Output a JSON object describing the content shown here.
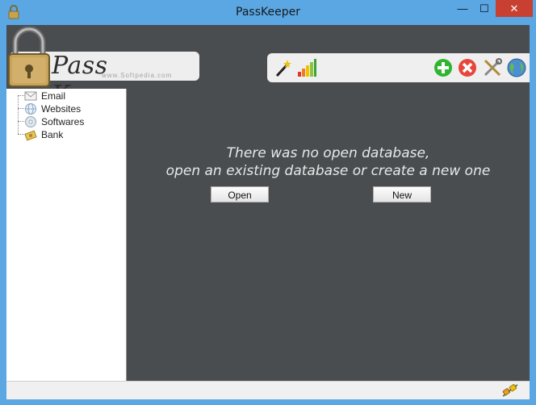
{
  "window": {
    "title": "PassKeeper",
    "minimize_label": "—",
    "maximize_label": "☐",
    "close_label": "✕"
  },
  "logo": {
    "text": "Pass Keeper",
    "watermark": "www.Softpedia.com"
  },
  "toolbar": {
    "icons": [
      "magic-wand-icon",
      "signal-bars-icon",
      "add-icon",
      "delete-icon",
      "settings-tools-icon",
      "globe-icon"
    ]
  },
  "tree": {
    "items": [
      {
        "label": "Email",
        "icon": "envelope-icon"
      },
      {
        "label": "Websites",
        "icon": "globe-small-icon"
      },
      {
        "label": "Softwares",
        "icon": "cd-icon"
      },
      {
        "label": "Bank",
        "icon": "money-icon"
      }
    ]
  },
  "main": {
    "message_line1": "There was no open database,",
    "message_line2": "open an existing database or create a new one",
    "open_label": "Open",
    "new_label": "New"
  },
  "colors": {
    "accent": "#5aa7e4",
    "client_bg": "#4a4d50",
    "close_red": "#c84031"
  }
}
